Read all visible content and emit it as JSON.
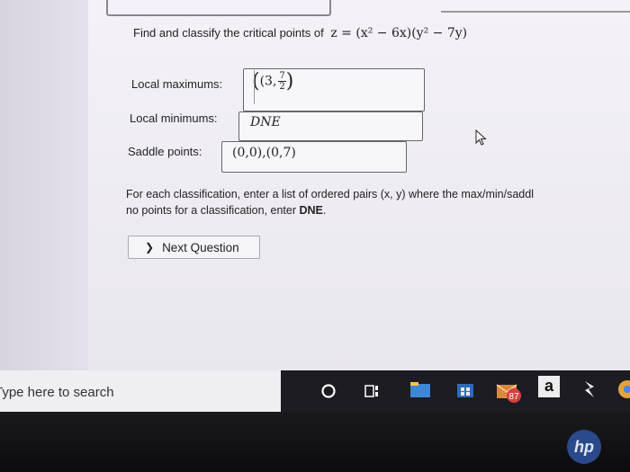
{
  "question": {
    "prefix": "Find and classify the critical points of",
    "equation": "z = (x² − 6x)(y² − 7y)"
  },
  "fields": {
    "max_label": "Local maximums:",
    "max_value_open": "(3,",
    "max_frac_num": "7",
    "max_frac_den": "2",
    "max_value_close": ")",
    "min_label": "Local minimums:",
    "min_value": "DNE",
    "saddle_label": "Saddle points:",
    "saddle_value": "(0,0),(0,7)"
  },
  "instructions": {
    "line1": "For each classification, enter a list of ordered pairs (x, y) where the max/min/saddl",
    "line2_prefix": "no points for a classification, enter ",
    "line2_bold": "DNE",
    "line2_suffix": "."
  },
  "next_button": {
    "label": "Next Question"
  },
  "taskbar": {
    "search_placeholder": "Type here to search",
    "badge_count": "87",
    "amazon_letter": "a"
  },
  "brand": {
    "logo_text": "hp"
  }
}
